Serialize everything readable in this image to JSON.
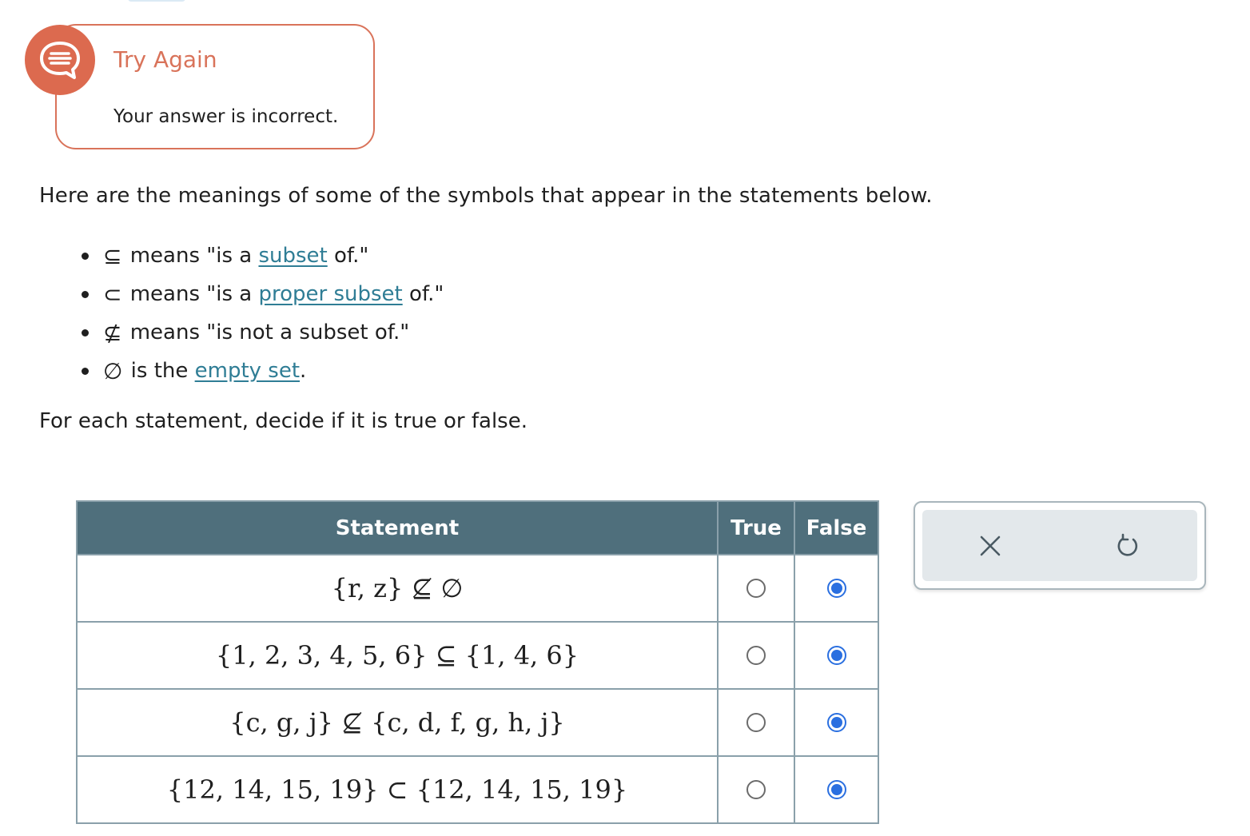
{
  "feedback": {
    "title": "Try Again",
    "message": "Your answer is incorrect."
  },
  "intro": "Here are the meanings of some of the symbols that appear in the statements below.",
  "symbols": [
    {
      "symbol": "⊆",
      "prefix": " means \"is a ",
      "link": "subset",
      "suffix": " of.\""
    },
    {
      "symbol": "⊂",
      "prefix": " means \"is a ",
      "link": "proper subset",
      "suffix": " of.\""
    },
    {
      "symbol": "⊈",
      "prefix": " means \"is not a subset of.\"",
      "link": "",
      "suffix": ""
    },
    {
      "symbol": "∅",
      "prefix": " is the ",
      "link": "empty set",
      "suffix": "."
    }
  ],
  "instruction": "For each statement, decide if it is true or false.",
  "table": {
    "headers": {
      "statement": "Statement",
      "true": "True",
      "false": "False"
    },
    "rows": [
      {
        "statement": "{r, z} ⊈ ∅",
        "selected": "false"
      },
      {
        "statement": "{1, 2, 3, 4, 5, 6} ⊆ {1, 4, 6}",
        "selected": "false"
      },
      {
        "statement": "{c, g, j} ⊈ {c, d, f, g, h, j}",
        "selected": "false"
      },
      {
        "statement": "{12, 14, 15, 19} ⊂ {12, 14, 15, 19}",
        "selected": "false"
      }
    ]
  },
  "icons": {
    "feedback": "chat-bubble-icon",
    "clear": "close-icon",
    "undo": "undo-icon"
  },
  "colors": {
    "feedback_accent": "#d9735a",
    "header_bg": "#4f6f7c",
    "link": "#2f7d95",
    "radio_selected": "#2a6fe0"
  }
}
